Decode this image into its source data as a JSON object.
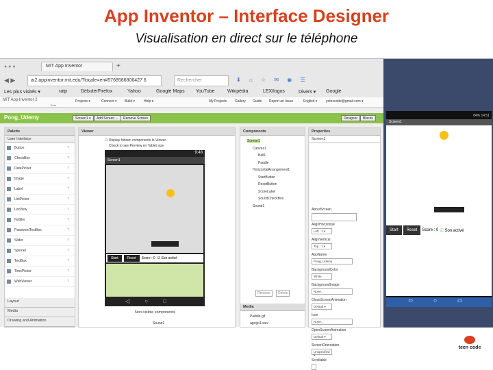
{
  "slide": {
    "title": "App Inventor – Interface Designer",
    "subtitle": "Visualisation en direct sur le téléphone"
  },
  "browser": {
    "tab": "MIT App Inventor",
    "url": "ai2.appinventor.mit.edu/?locale=en#5768586806427 6",
    "search_placeholder": "Rechercher",
    "bookmarks": [
      "Les plus visités ▾",
      "ratp",
      "DébuterFirefox",
      "Yahoo",
      "Google Maps",
      "YouTube",
      "Wikipédia",
      "LEXIlogos",
      "Divers ▾",
      "Google"
    ]
  },
  "appinventor": {
    "logo": "MIT App Inventor 2",
    "beta": "Beta",
    "menus": [
      "Projects ▾",
      "Connect ▾",
      "Build ▾",
      "Help ▾"
    ],
    "top_links": [
      "My Projects",
      "Gallery",
      "Guide",
      "Report an Issue",
      "English ▾",
      "yotexcode@gmail.com ▾"
    ],
    "project": "Pong_Udemy",
    "screen_btn": "Screen1 ▾",
    "add_screen": "Add Screen ...",
    "remove_screen": "Remove Screen",
    "designer": "Designer",
    "blocks": "Blocks",
    "palette": {
      "header": "Palette",
      "section": "User Interface",
      "items": [
        "Button",
        "CheckBox",
        "DatePicker",
        "Image",
        "Label",
        "ListPicker",
        "ListView",
        "Notifier",
        "PasswordTextBox",
        "Slider",
        "Spinner",
        "TextBox",
        "TimePicker",
        "WebViewer"
      ],
      "bottom": [
        "Layout",
        "Media",
        "Drawing and Animation"
      ]
    },
    "viewer": {
      "header": "Viewer",
      "chk1": "Display hidden components in Viewer",
      "chk2": "Check to see Preview on Tablet size",
      "time": "9:48",
      "screen": "Screen1",
      "start": "Start",
      "reset": "Reset",
      "score": "Score : 0",
      "son": "Son activé",
      "nonvisible": "Non-visible components",
      "sound": "Sound1"
    },
    "components": {
      "header": "Components",
      "tree": [
        "Screen1",
        "Canvas1",
        "Ball1",
        "Paddle",
        "HorizontalArrangement1",
        "StartButton",
        "ResetButton",
        "ScoreLabel",
        "SoundCheckBox",
        "Sound1"
      ],
      "rename": "Rename",
      "delete": "Delete",
      "media_h": "Media",
      "media": [
        "Paddle.gif",
        "agogo1.wav"
      ]
    },
    "properties": {
      "header": "Properties",
      "screen": "Screen1",
      "items": [
        {
          "label": "AboutScreen",
          "value": ""
        },
        {
          "label": "AlignHorizontal",
          "value": "Left : 1 ▾"
        },
        {
          "label": "AlignVertical",
          "value": "Top : 1 ▾"
        },
        {
          "label": "AppName",
          "value": "Pong_Udemy"
        },
        {
          "label": "BackgroundColor",
          "value": "White"
        },
        {
          "label": "BackgroundImage",
          "value": "None..."
        },
        {
          "label": "CloseScreenAnimation",
          "value": "Default ▾"
        },
        {
          "label": "Icon",
          "value": "None..."
        },
        {
          "label": "OpenScreenAnimation",
          "value": "Default ▾"
        },
        {
          "label": "ScreenOrientation",
          "value": "Unspecified ▾"
        },
        {
          "label": "Scrollable",
          "value": ""
        }
      ]
    }
  },
  "phone": {
    "status": "84% 14:51",
    "screen": "Screen1",
    "start": "Start",
    "reset": "Reset",
    "score": "Score : 0",
    "son": "Son activé"
  },
  "logo": {
    "text": "teen code"
  }
}
